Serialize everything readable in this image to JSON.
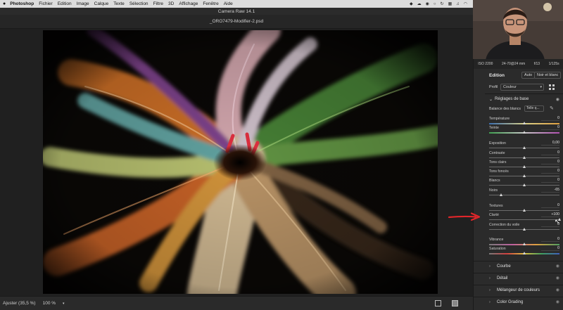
{
  "menubar": {
    "app": "Photoshop",
    "items": [
      "Fichier",
      "Edition",
      "Image",
      "Calque",
      "Texte",
      "Sélection",
      "Filtre",
      "3D",
      "Affichage",
      "Fenêtre",
      "Aide"
    ]
  },
  "window": {
    "title": "Camera Raw 14.1",
    "filename": "_ORO7479-Modifier-2.psd"
  },
  "bottombar": {
    "zoom_label": "Ajuster (35,5 %)",
    "zoom_value": "100 %"
  },
  "metadata": {
    "iso": "ISO 2200",
    "lens": "24-70@24 mm",
    "aperture": "f/13",
    "shutter": "1/125s"
  },
  "edition": {
    "title": "Edition",
    "auto_label": "Auto",
    "bw_label": "Noir et blanc"
  },
  "profil": {
    "label": "Profil",
    "value": "Couleur"
  },
  "basic": {
    "title": "Réglages de base",
    "wb_label": "Balance des blancs",
    "wb_value": "Telle q...",
    "sliders": [
      {
        "label": "Température",
        "value": "0",
        "level": 0.5
      },
      {
        "label": "Teinte",
        "value": "0",
        "level": 0.5
      },
      {
        "label": "Exposition",
        "value": "0,00",
        "level": 0.5
      },
      {
        "label": "Contraste",
        "value": "0",
        "level": 0.5
      },
      {
        "label": "Tons clairs",
        "value": "0",
        "level": 0.5
      },
      {
        "label": "Tons foncés",
        "value": "0",
        "level": 0.5
      },
      {
        "label": "Blancs",
        "value": "0",
        "level": 0.5
      },
      {
        "label": "Noirs",
        "value": "-65",
        "level": 0.175
      },
      {
        "label": "Textures",
        "value": "0",
        "level": 0.5
      },
      {
        "label": "Clarté",
        "value": "+100",
        "level": 1.0
      },
      {
        "label": "Correction du voile",
        "value": "0",
        "level": 0.5
      },
      {
        "label": "Vibrance",
        "value": "0",
        "level": 0.5
      },
      {
        "label": "Saturation",
        "value": "0",
        "level": 0.5
      }
    ]
  },
  "sections": [
    "Courbe",
    "Détail",
    "Mélangeur de couleurs",
    "Color Grading"
  ],
  "colors": {
    "panel_bg": "#2b2b2b",
    "canvas_bg": "#202020",
    "annotation_arrow": "#e0262a"
  }
}
